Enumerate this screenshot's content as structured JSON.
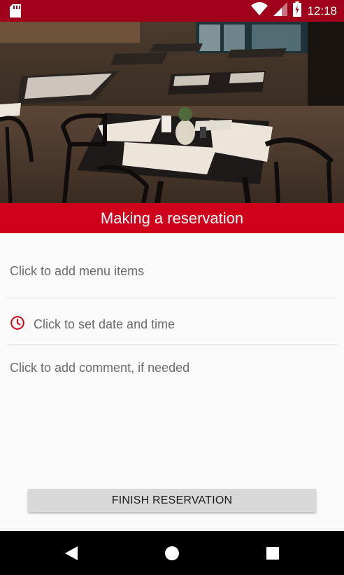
{
  "status_bar": {
    "time": "12:18",
    "icons": [
      "sd-card-icon",
      "wifi-icon",
      "cell-signal-icon",
      "battery-icon"
    ],
    "background": "#a0001a"
  },
  "hero": {
    "image": "restaurant-interior-photo"
  },
  "header": {
    "title": "Making a reservation",
    "background": "#d0021b"
  },
  "form": {
    "menu_items_label": "Click to add menu items",
    "datetime_label": "Click to set date and time",
    "datetime_icon": "clock-icon",
    "comment_placeholder": "Click to add comment, if needed"
  },
  "actions": {
    "finish_label": "FINISH RESERVATION"
  },
  "nav_bar": {
    "icons": [
      "back-icon",
      "home-icon",
      "recents-icon"
    ]
  }
}
